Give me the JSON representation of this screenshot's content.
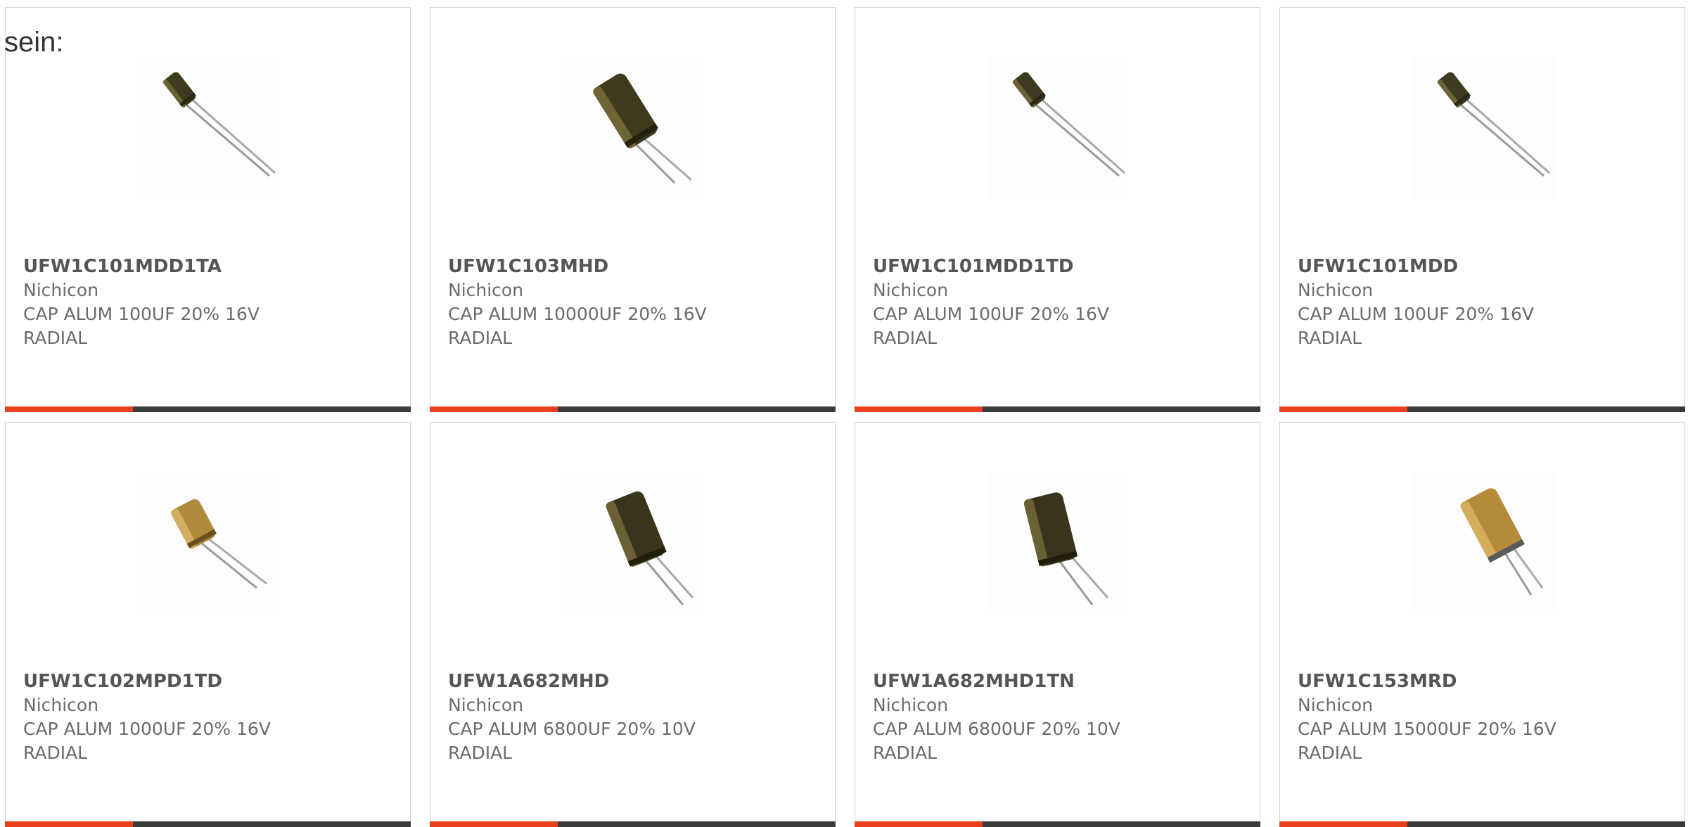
{
  "intro_text": "sein:",
  "colors": {
    "accent": "#e8401c",
    "bar": "#3b3b3b",
    "border": "#d3d3d3",
    "text": "#6b6b6b"
  },
  "products": [
    {
      "part_number": "UFW1C101MDD1TA",
      "manufacturer": "Nichicon",
      "description": "CAP ALUM 100UF 20% 16V\nRADIAL",
      "image": {
        "icon": "capacitor-small-dark-icon",
        "body_color": "#3e3a1f",
        "size": "small"
      }
    },
    {
      "part_number": "UFW1C103MHD",
      "manufacturer": "Nichicon",
      "description": "CAP ALUM 10000UF 20% 16V\nRADIAL",
      "image": {
        "icon": "capacitor-large-dark-icon",
        "body_color": "#3f3a1c",
        "size": "large"
      }
    },
    {
      "part_number": "UFW1C101MDD1TD",
      "manufacturer": "Nichicon",
      "description": "CAP ALUM 100UF 20% 16V\nRADIAL",
      "image": {
        "icon": "capacitor-small-dark-icon",
        "body_color": "#3e3a1f",
        "size": "small"
      }
    },
    {
      "part_number": "UFW1C101MDD",
      "manufacturer": "Nichicon",
      "description": "CAP ALUM 100UF 20% 16V\nRADIAL",
      "image": {
        "icon": "capacitor-small-dark-icon",
        "body_color": "#3e3a1f",
        "size": "small"
      }
    },
    {
      "part_number": "UFW1C102MPD1TD",
      "manufacturer": "Nichicon",
      "description": "CAP ALUM 1000UF 20% 16V\nRADIAL",
      "image": {
        "icon": "capacitor-medium-gold-icon",
        "body_color": "#b08a3c",
        "size": "medium"
      }
    },
    {
      "part_number": "UFW1A682MHD",
      "manufacturer": "Nichicon",
      "description": "CAP ALUM 6800UF 20% 10V\nRADIAL",
      "image": {
        "icon": "capacitor-large-dark-icon",
        "body_color": "#3a341c",
        "size": "large"
      }
    },
    {
      "part_number": "UFW1A682MHD1TN",
      "manufacturer": "Nichicon",
      "description": "CAP ALUM 6800UF 20% 10V\nRADIAL",
      "image": {
        "icon": "capacitor-large-dark-icon",
        "body_color": "#3a341c",
        "size": "large"
      }
    },
    {
      "part_number": "UFW1C153MRD",
      "manufacturer": "Nichicon",
      "description": "CAP ALUM 15000UF 20% 16V\nRADIAL",
      "image": {
        "icon": "capacitor-large-gold-icon",
        "body_color": "#b58a3a",
        "size": "large"
      }
    }
  ]
}
